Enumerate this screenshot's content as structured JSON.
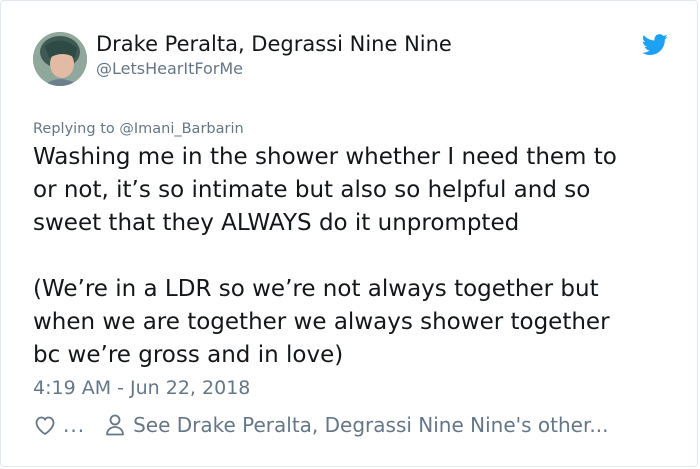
{
  "author": {
    "display_name": "Drake Peralta, Degrassi Nine Nine",
    "handle": "@LetsHearItForMe",
    "avatar_icon": "profile-photo"
  },
  "brand": {
    "icon": "twitter-bird-icon",
    "color": "#1da1f2"
  },
  "reply": {
    "prefix": "Replying to",
    "to": "@Imani_Barbarin"
  },
  "tweet": {
    "lines": [
      "Washing me in the shower whether I need them to",
      "or not, it’s so intimate but also so helpful and so",
      "sweet that they ALWAYS do it unprompted",
      "",
      "(We’re in a LDR so we’re not always together but",
      "when we are together we always shower together",
      "bc we’re gross and in love)"
    ]
  },
  "timestamp": "4:19 AM - Jun 22, 2018",
  "actions": {
    "like_icon": "heart-icon",
    "like_more": "...",
    "profile_icon": "person-icon",
    "see_other": "See Drake Peralta, Degrassi Nine Nine's other..."
  },
  "colors": {
    "text_primary": "#14171a",
    "text_secondary": "#657786",
    "border": "#e1e8ed"
  }
}
